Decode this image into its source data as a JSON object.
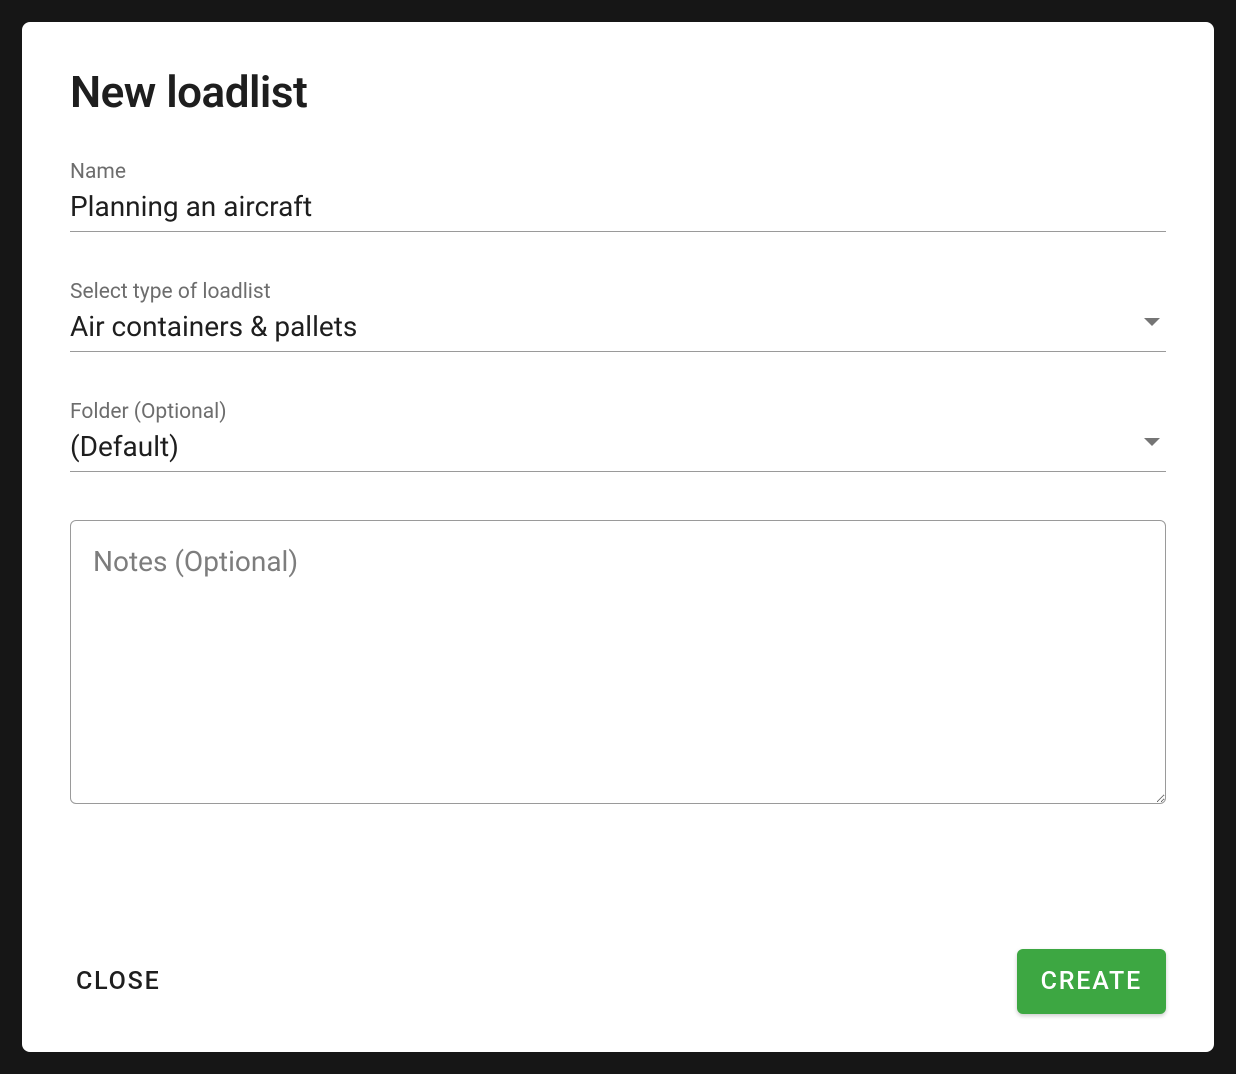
{
  "dialog": {
    "title": "New loadlist",
    "fields": {
      "name": {
        "label": "Name",
        "value": "Planning an aircraft"
      },
      "type": {
        "label": "Select type of loadlist",
        "value": "Air containers & pallets"
      },
      "folder": {
        "label": "Folder (Optional)",
        "value": "(Default)"
      },
      "notes": {
        "placeholder": "Notes (Optional)",
        "value": ""
      }
    },
    "actions": {
      "close_label": "CLOSE",
      "create_label": "CREATE"
    }
  }
}
